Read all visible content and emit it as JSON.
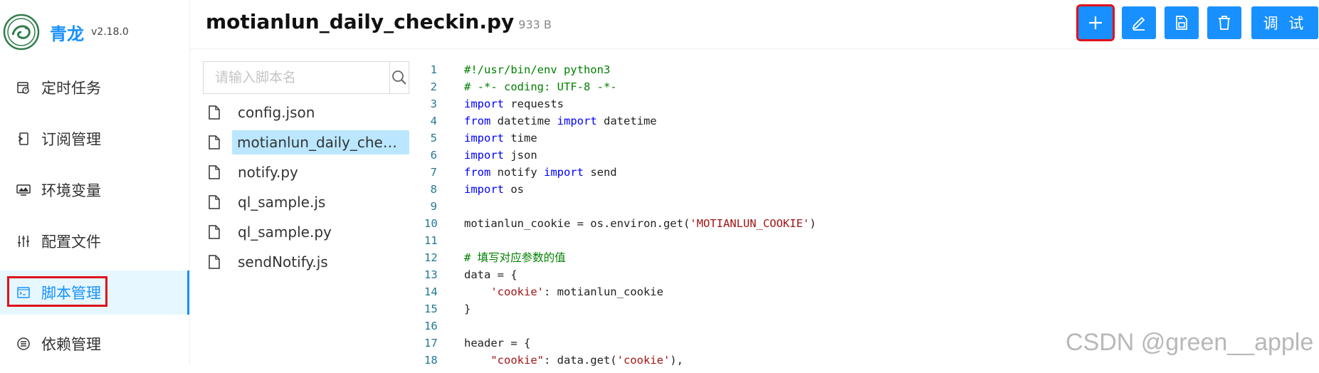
{
  "app": {
    "name": "青龙",
    "version": "v2.18.0"
  },
  "sidebar": {
    "items": [
      {
        "label": "定时任务",
        "icon": "calendar-clock-icon"
      },
      {
        "label": "订阅管理",
        "icon": "subscription-icon"
      },
      {
        "label": "环境变量",
        "icon": "monitor-icon"
      },
      {
        "label": "配置文件",
        "icon": "sliders-icon"
      },
      {
        "label": "脚本管理",
        "icon": "code-window-icon",
        "active": true
      },
      {
        "label": "依赖管理",
        "icon": "list-circle-icon"
      }
    ]
  },
  "header": {
    "file_title": "motianlun_daily_checkin.py",
    "file_size": "933 B",
    "toolbar": {
      "add_icon": "plus-icon",
      "edit_icon": "pencil-icon",
      "save_icon": "save-file-icon",
      "delete_icon": "trash-icon",
      "debug_label": "调 试"
    }
  },
  "file_tree": {
    "search_placeholder": "请输入脚本名",
    "files": [
      {
        "name": "config.json"
      },
      {
        "name": "motianlun_daily_checkin.py",
        "selected": true
      },
      {
        "name": "notify.py"
      },
      {
        "name": "ql_sample.js"
      },
      {
        "name": "ql_sample.py"
      },
      {
        "name": "sendNotify.js"
      }
    ]
  },
  "editor": {
    "lines": [
      {
        "n": "1",
        "tokens": [
          [
            "cm",
            "#!/usr/bin/env python3"
          ]
        ]
      },
      {
        "n": "2",
        "tokens": [
          [
            "cm",
            "# -*- coding: UTF-8 -*-"
          ]
        ]
      },
      {
        "n": "3",
        "tokens": [
          [
            "kw",
            "import"
          ],
          [
            "",
            " requests"
          ]
        ]
      },
      {
        "n": "4",
        "tokens": [
          [
            "kw",
            "from"
          ],
          [
            "",
            " datetime "
          ],
          [
            "kw",
            "import"
          ],
          [
            "",
            " datetime"
          ]
        ]
      },
      {
        "n": "5",
        "tokens": [
          [
            "kw",
            "import"
          ],
          [
            "",
            " time"
          ]
        ]
      },
      {
        "n": "6",
        "tokens": [
          [
            "kw",
            "import"
          ],
          [
            "",
            " json"
          ]
        ]
      },
      {
        "n": "7",
        "tokens": [
          [
            "kw",
            "from"
          ],
          [
            "",
            " notify "
          ],
          [
            "kw",
            "import"
          ],
          [
            "",
            " send"
          ]
        ]
      },
      {
        "n": "8",
        "tokens": [
          [
            "kw",
            "import"
          ],
          [
            "",
            " os"
          ]
        ]
      },
      {
        "n": "9",
        "tokens": []
      },
      {
        "n": "10",
        "tokens": [
          [
            "",
            "motianlun_cookie = os.environ.get("
          ],
          [
            "st",
            "'MOTIANLUN_COOKIE'"
          ],
          [
            "",
            ")"
          ]
        ]
      },
      {
        "n": "11",
        "tokens": []
      },
      {
        "n": "12",
        "tokens": [
          [
            "cm",
            "# 填写对应参数的值"
          ]
        ]
      },
      {
        "n": "13",
        "tokens": [
          [
            "",
            "data = {"
          ]
        ]
      },
      {
        "n": "14",
        "tokens": [
          [
            "",
            "    "
          ],
          [
            "st",
            "'cookie'"
          ],
          [
            "",
            ": motianlun_cookie"
          ]
        ]
      },
      {
        "n": "15",
        "tokens": [
          [
            "",
            "}"
          ]
        ]
      },
      {
        "n": "16",
        "tokens": []
      },
      {
        "n": "17",
        "tokens": [
          [
            "",
            "header = {"
          ]
        ]
      },
      {
        "n": "18",
        "tokens": [
          [
            "",
            "    "
          ],
          [
            "st",
            "\"cookie\""
          ],
          [
            "",
            ": data.get("
          ],
          [
            "st",
            "'cookie'"
          ],
          [
            "",
            "),"
          ]
        ]
      }
    ]
  },
  "watermark": "CSDN @green__apple",
  "colors": {
    "accent": "#1890ff",
    "highlight_box": "#e0101a",
    "selected_bg": "#bae7ff"
  }
}
